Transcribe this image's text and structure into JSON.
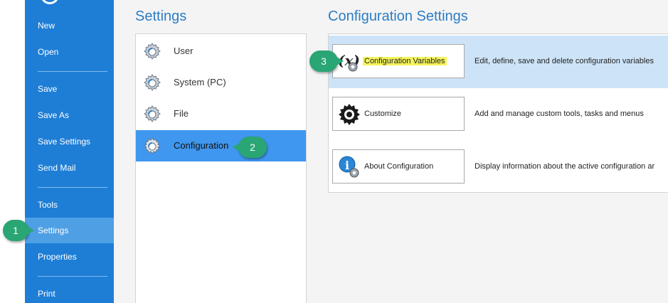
{
  "nav": {
    "items": [
      {
        "label": "New"
      },
      {
        "label": "Open"
      },
      {
        "label": "Save"
      },
      {
        "label": "Save As"
      },
      {
        "label": "Save Settings"
      },
      {
        "label": "Send Mail"
      },
      {
        "label": "Tools"
      },
      {
        "label": "Settings",
        "active": true
      },
      {
        "label": "Properties"
      },
      {
        "label": "Print"
      }
    ],
    "background": "#1e7ed6",
    "active_background": "#4e9fe4"
  },
  "settings": {
    "title": "Settings",
    "items": [
      {
        "label": "User",
        "icon": "gear-icon"
      },
      {
        "label": "System (PC)",
        "icon": "gear-icon"
      },
      {
        "label": "File",
        "icon": "gear-icon"
      },
      {
        "label": "Configuration",
        "icon": "gear-icon",
        "active": true
      }
    ],
    "active_color": "#3f97ef"
  },
  "configuration": {
    "title": "Configuration Settings",
    "rows": [
      {
        "button_label": "Configuration Variables",
        "description": "Edit, define, save and delete configuration variables",
        "icon": "variables-icon",
        "highlighted": true
      },
      {
        "button_label": "Customize",
        "description": "Add and manage custom tools, tasks and menus",
        "icon": "customize-gear-icon"
      },
      {
        "button_label": "About Configuration",
        "description": "Display information about the active configuration ar",
        "icon": "info-icon"
      }
    ],
    "highlight_color": "#cde3f7",
    "label_highlight_color": "#f3f35b"
  },
  "callouts": {
    "step1": "1",
    "step2": "2",
    "step3": "3",
    "color": "#2aa574"
  },
  "accent_title_color": "#2c7dc4"
}
